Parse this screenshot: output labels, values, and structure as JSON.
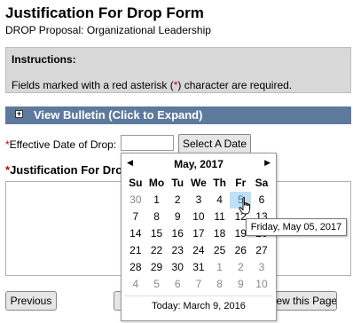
{
  "form": {
    "title": "Justification For Drop Form",
    "subtitle": "DROP Proposal: Organizational Leadership"
  },
  "instructions": {
    "heading": "Instructions:",
    "text_before": "Fields marked with a red asterisk (",
    "asterisk": "*",
    "text_after": ") character are required."
  },
  "bulletin": {
    "label": "View Bulletin (Click to Expand)",
    "toggle_symbol": "+"
  },
  "effective_date": {
    "asterisk": "*",
    "label": "Effective Date of Drop:",
    "value": "",
    "select_button": "Select A Date"
  },
  "justification": {
    "asterisk": "*",
    "label": "Justification For Dro"
  },
  "buttons": {
    "previous": "Previous",
    "view_page": "View this Page"
  },
  "calendar": {
    "prev_symbol": "◀",
    "next_symbol": "▶",
    "month_label": "May, 2017",
    "weekdays": [
      "Su",
      "Mo",
      "Tu",
      "We",
      "Th",
      "Fr",
      "Sa"
    ],
    "weeks": [
      [
        "30",
        "1",
        "2",
        "3",
        "4",
        "5",
        "6"
      ],
      [
        "7",
        "8",
        "9",
        "10",
        "11",
        "12",
        "13"
      ],
      [
        "14",
        "15",
        "16",
        "17",
        "18",
        "19",
        "20"
      ],
      [
        "21",
        "22",
        "23",
        "24",
        "25",
        "26",
        "27"
      ],
      [
        "28",
        "29",
        "30",
        "31",
        "1",
        "2",
        "3"
      ],
      [
        "4",
        "5",
        "6",
        "7",
        "8",
        "9",
        "10"
      ]
    ],
    "selected_day": "5",
    "today_label": "Today: March 9, 2016",
    "tooltip": "Friday, May 05, 2017"
  },
  "colors": {
    "bulletin_bar": "#5d7a9c",
    "asterisk": "#cc0000",
    "selected_day_bg": "#bfe0f5"
  }
}
